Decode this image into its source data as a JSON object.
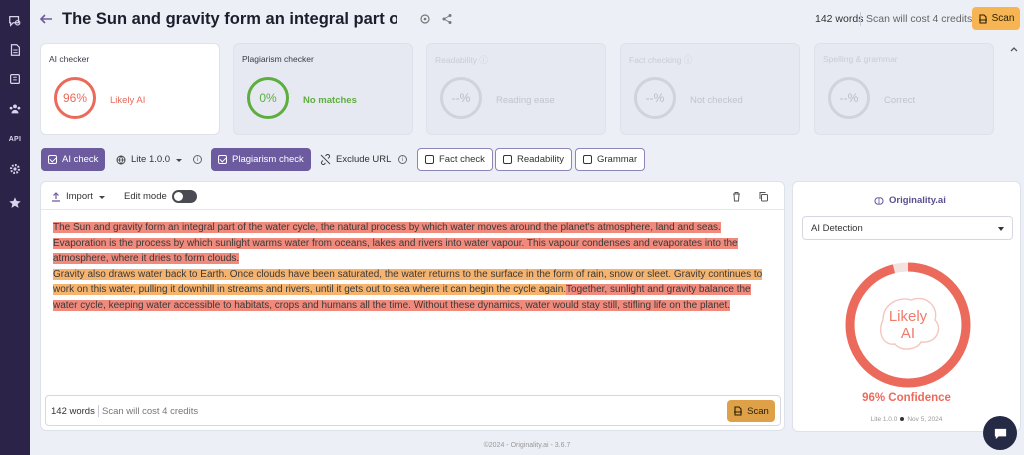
{
  "colors": {
    "sidebar": "#2c2348",
    "accent_purple": "#6d5b9f",
    "scan_orange": "#f6b552",
    "ai_red": "#ec6a5c",
    "original_green": "#5eae3f"
  },
  "sidebar": {
    "items": [
      {
        "icon": "chat-search-icon"
      },
      {
        "icon": "document-icon"
      },
      {
        "icon": "library-icon"
      },
      {
        "icon": "team-icon"
      },
      {
        "icon": "api-icon",
        "label": "API"
      },
      {
        "icon": "gear-icon"
      },
      {
        "icon": "star-icon"
      }
    ]
  },
  "header": {
    "title": "The Sun and gravity form an integral part of the w",
    "word_count": "142 words",
    "cost": "Scan will cost 4 credits",
    "scan_label": "Scan"
  },
  "cards": [
    {
      "title": "AI checker",
      "value": "96%",
      "status": "Likely AI",
      "state": "active",
      "color": "#ec6a5c"
    },
    {
      "title": "Plagiarism checker",
      "value": "0%",
      "status": "No matches",
      "state": "enabled",
      "color": "#5eae3f"
    },
    {
      "title": "Readability ⓘ",
      "value": "--%",
      "status": "Reading ease",
      "state": "dim"
    },
    {
      "title": "Fact checking ⓘ",
      "value": "--%",
      "status": "Not checked",
      "state": "dim"
    },
    {
      "title": "Spelling & grammar",
      "value": "--%",
      "status": "Correct",
      "state": "dim"
    }
  ],
  "toolbar": {
    "ai_check": "AI check",
    "model": "Lite 1.0.0",
    "plagiarism_check": "Plagiarism check",
    "exclude_url": "Exclude URL",
    "fact_check": "Fact check",
    "readability": "Readability",
    "grammar": "Grammar"
  },
  "editor": {
    "import_label": "Import",
    "edit_mode_label": "Edit mode",
    "edit_mode_on": false,
    "segments": [
      {
        "text": "The Sun and gravity form an integral part of the water cycle, the natural process by which water moves around the planet's atmosphere, land and seas. Evaporation is the process by which sunlight warms water from oceans, lakes and rivers into water vapour. This vapour condenses and evaporates into the atmosphere, where it dries to form clouds.",
        "hl": "red"
      },
      {
        "text": "Gravity also draws water back to Earth. Once clouds have been saturated, the water returns to the surface in the form of rain, snow or sleet. Gravity continues to work on this water, pulling it downhill in streams and rivers, until it gets out to sea where it can begin the cycle again.",
        "hl": "orange"
      },
      {
        "text": "Together, sunlight and gravity balance the water cycle, keeping water accessible to habitats, crops and humans all the time. Without these dynamics, water would stay still, stifling life on the planet.",
        "hl": "red"
      }
    ],
    "footer_words": "142 words",
    "footer_cost": "Scan will cost 4 credits",
    "scan_label": "Scan"
  },
  "result": {
    "brand": "Originality.ai",
    "detection_mode": "AI Detection",
    "verdict_line1": "Likely",
    "verdict_line2": "AI",
    "ai_fraction": 0.96,
    "confidence": "96% Confidence",
    "model": "Lite 1.0.0",
    "date": "Nov 5, 2024"
  },
  "footer": "©2024 - Originality.ai - 3.6.7"
}
